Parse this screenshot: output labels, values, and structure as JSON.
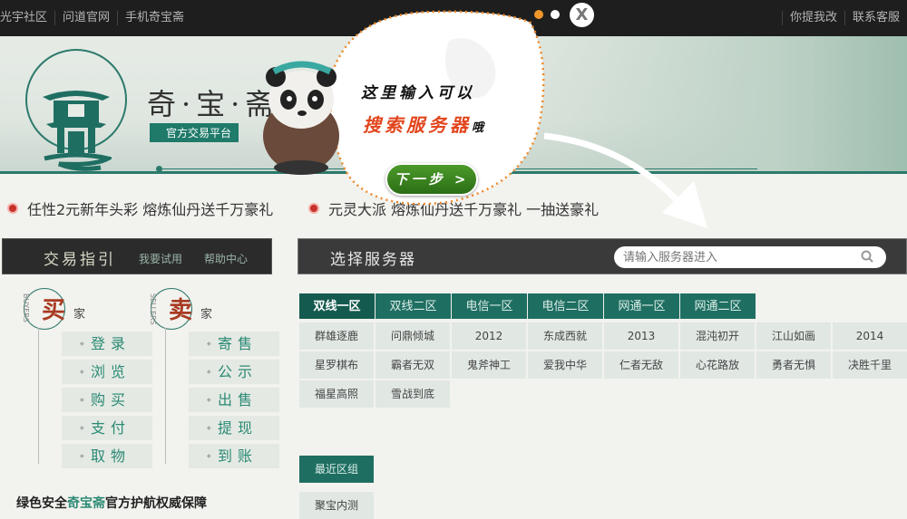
{
  "topbar": {
    "left_links": [
      "光宇社区",
      "问道官网",
      "手机奇宝斋"
    ],
    "right_links": [
      "你提我改",
      "联系客服"
    ]
  },
  "header": {
    "logo_title": "奇·宝·斋",
    "logo_subtitle": "官方交易平台"
  },
  "announcements": [
    "任性2元新年头彩 熔炼仙丹送千万豪礼",
    "元灵大派 熔炼仙丹送千万豪礼 一抽送豪礼"
  ],
  "guide": {
    "title": "交易指引",
    "links": [
      "我要试用",
      "帮助中心"
    ]
  },
  "buyer": {
    "char": "买",
    "label": "家",
    "vertical": "BUYERS",
    "items": [
      "登录",
      "浏览",
      "购买",
      "支付",
      "取物"
    ]
  },
  "seller": {
    "char": "卖",
    "label": "家",
    "vertical": "SELLERS",
    "items": [
      "寄售",
      "公示",
      "出售",
      "提现",
      "到账"
    ]
  },
  "safety": {
    "prefix": "绿色安全",
    "brand": "奇宝斋",
    "suffix": "官方护航权威保障"
  },
  "server": {
    "title": "选择服务器",
    "search_placeholder": "请输入服务器进入",
    "tabs": [
      "双线一区",
      "双线二区",
      "电信一区",
      "电信二区",
      "网通一区",
      "网通二区"
    ],
    "active_tab": "双线一区",
    "servers": [
      "群雄逐鹿",
      "问鼎倾城",
      "2012",
      "东成西就",
      "2013",
      "混沌初开",
      "江山如画",
      "2014",
      "星罗棋布",
      "霸者无双",
      "鬼斧神工",
      "爱我中华",
      "仁者无敌",
      "心花路放",
      "勇者无惧",
      "决胜千里",
      "福星高照",
      "雪战到底"
    ],
    "recent_tab": "最近区组",
    "recent": [
      "聚宝内测"
    ]
  },
  "tour": {
    "line1": "这里输入可以",
    "line2": "搜索服务器",
    "line2_suffix": "哦",
    "next": "下一步 >",
    "close": "X"
  },
  "colors": {
    "accent": "#1f6e62",
    "topbar": "#1e1e1e",
    "tip_highlight": "#e2451c",
    "next_button": "#3d8a22",
    "dot_active": "#f0962a"
  }
}
